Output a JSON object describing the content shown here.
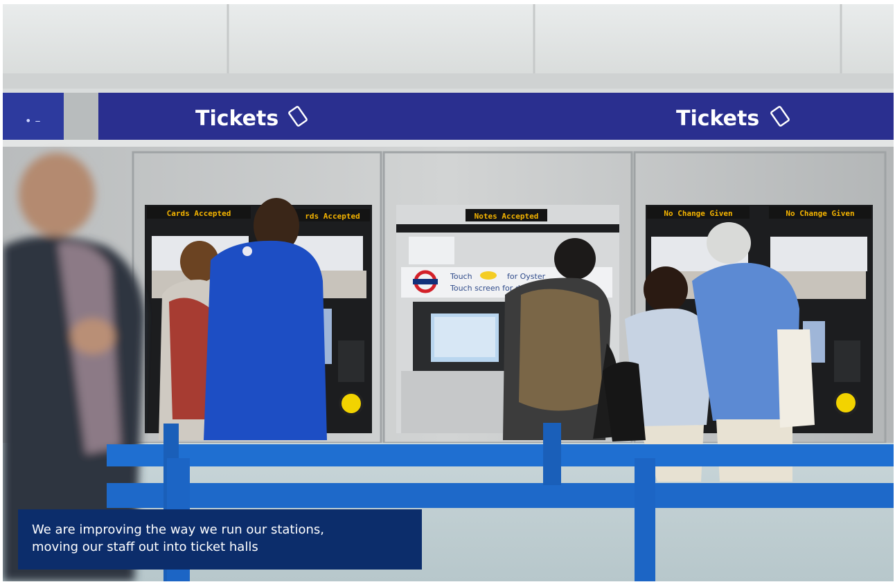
{
  "photo": {
    "signs": [
      "Tickets",
      "Tickets"
    ],
    "machine_displays": [
      "Cards Accepted",
      "rds Accepted",
      "Notes Accepted",
      "No Change Given",
      "No Change Given"
    ],
    "panel_text": [
      "Touch",
      "for Oyster",
      "Touch screen for de"
    ]
  },
  "caption": {
    "line1": "We are improving the way we run our stations,",
    "line2": "moving our staff out into ticket halls"
  },
  "colors": {
    "caption_bg": "#0c2d6b",
    "sign_blue": "#2a2f8f",
    "barrier_blue": "#1f6fd1"
  }
}
